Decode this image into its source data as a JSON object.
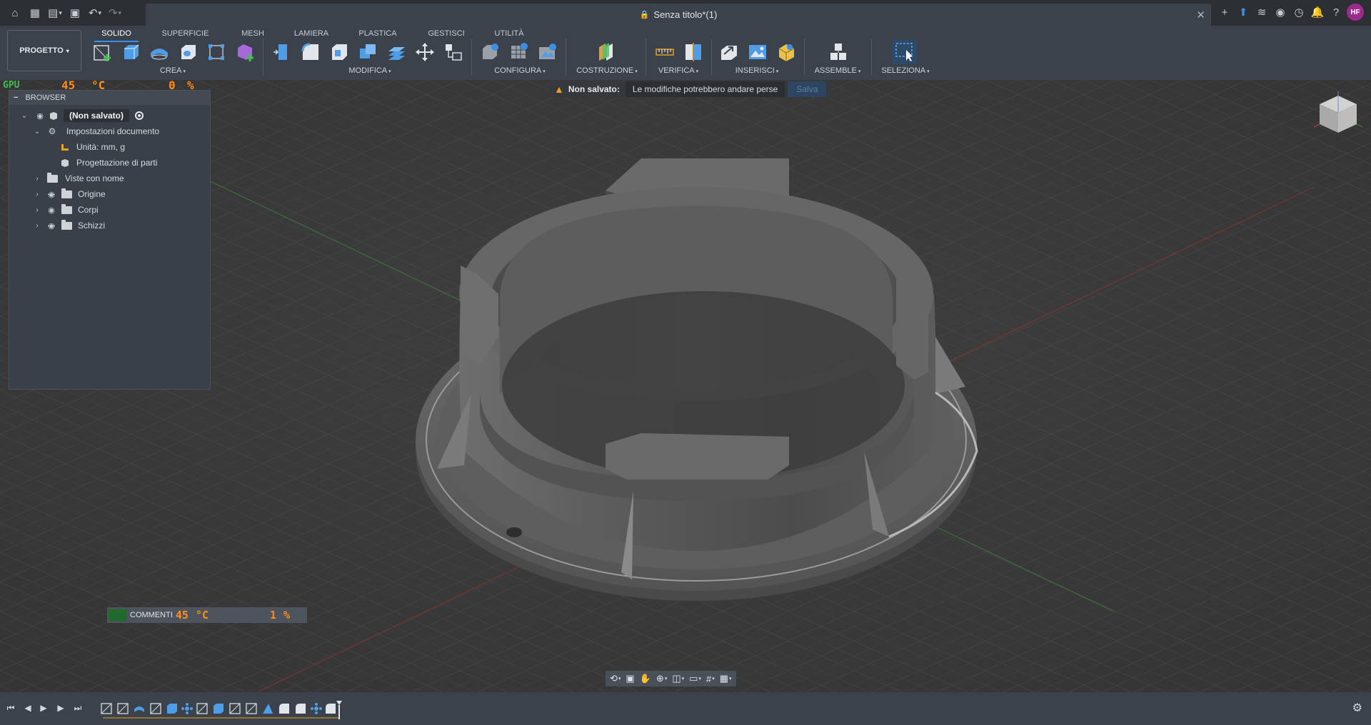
{
  "window": {
    "document_title": "Senza titolo*(1)",
    "user_initials": "HF"
  },
  "toolbar": {
    "project_label": "PROGETTO",
    "tabs": [
      "SOLIDO",
      "SUPERFICIE",
      "MESH",
      "LAMIERA",
      "PLASTICA",
      "GESTISCI",
      "UTILITÀ"
    ],
    "active_tab": "SOLIDO",
    "groups": [
      "CREA",
      "MODIFICA",
      "CONFIGURA",
      "COSTRUZIONE",
      "VERIFICA",
      "INSERISCI",
      "ASSEMBLE",
      "SELEZIONA"
    ]
  },
  "banner": {
    "label": "Non salvato:",
    "message": "Le modifiche potrebbero andare perse",
    "action": "Salva"
  },
  "browser": {
    "title": "BROWSER",
    "root": "(Non salvato)",
    "items": [
      {
        "label": "Impostazioni documento"
      },
      {
        "label": "Unità: mm, g"
      },
      {
        "label": "Progettazione di parti"
      },
      {
        "label": "Viste con nome"
      },
      {
        "label": "Origine"
      },
      {
        "label": "Corpi"
      },
      {
        "label": "Schizzi"
      }
    ]
  },
  "overlay": {
    "top_left": {
      "label": "GPU",
      "temp": "45",
      "unit": "°C",
      "load": "0",
      "pct": "%"
    },
    "comments": {
      "label": "COMMENTI",
      "temp": "45",
      "unit": "°C",
      "load": "1",
      "pct": "%"
    }
  },
  "colors": {
    "accent": "#3d8ee6",
    "warning": "#e8a31b",
    "overlay_digits": "#ff8c1a",
    "avatar": "#9b2b8e"
  }
}
